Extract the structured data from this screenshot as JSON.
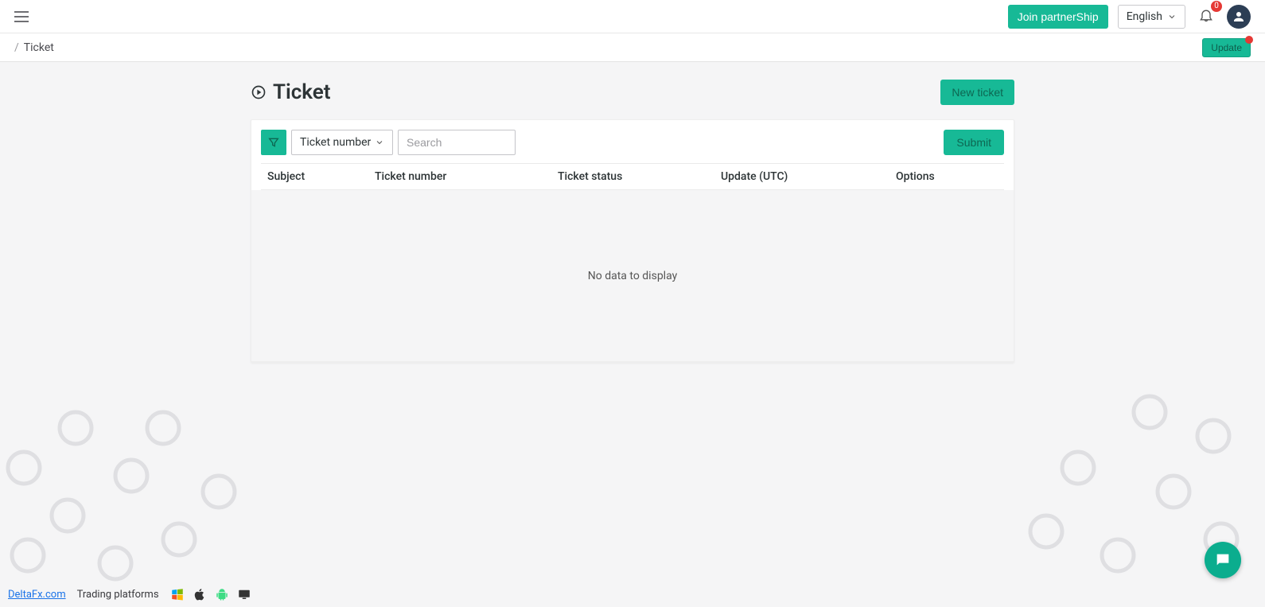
{
  "header": {
    "join_partnership": "Join partnerShip",
    "language": "English",
    "notification_count": "0"
  },
  "breadcrumb": {
    "separator": "/",
    "current": "Ticket"
  },
  "update_button": "Update",
  "page": {
    "title": "Ticket",
    "new_ticket": "New ticket"
  },
  "filter": {
    "dropdown_selected": "Ticket number",
    "search_placeholder": "Search",
    "submit": "Submit"
  },
  "table": {
    "columns": {
      "subject": "Subject",
      "number": "Ticket number",
      "status": "Ticket status",
      "update": "Update (UTC)",
      "options": "Options"
    },
    "empty_message": "No data to display"
  },
  "footer": {
    "site_link": "DeltaFx.com",
    "trading_platforms": "Trading platforms"
  }
}
